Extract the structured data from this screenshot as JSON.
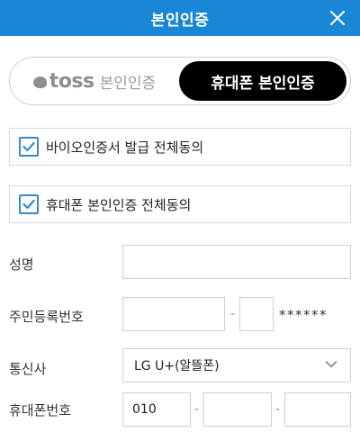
{
  "header": {
    "title": "본인인증"
  },
  "tabs": {
    "toss": {
      "logo_text": "toss",
      "suffix": "본인인증"
    },
    "phone": {
      "label": "휴대폰 본인인증"
    }
  },
  "agreements": [
    {
      "label": "바이오인증서 발급 전체동의",
      "checked": true
    },
    {
      "label": "휴대폰 본인인증 전체동의",
      "checked": true
    }
  ],
  "form": {
    "name": {
      "label": "성명",
      "value": ""
    },
    "resident_id": {
      "label": "주민등록번호",
      "front": "",
      "back_first_digit": "",
      "dash": "-",
      "mask": "******"
    },
    "carrier": {
      "label": "통신사",
      "selected": "LG U+(알뜰폰)"
    },
    "phone": {
      "label": "휴대폰번호",
      "prefix": "010",
      "middle": "",
      "last": "",
      "dash1": "-",
      "dash2": "-"
    }
  },
  "colors": {
    "header": "#1a87d6",
    "checkbox": "#3a88c8",
    "active_tab": "#000000"
  },
  "icons": {
    "close": "close-icon",
    "checkbox": "checkmark-icon",
    "select": "chevron-down-icon",
    "toss": "toss-logo-icon"
  }
}
